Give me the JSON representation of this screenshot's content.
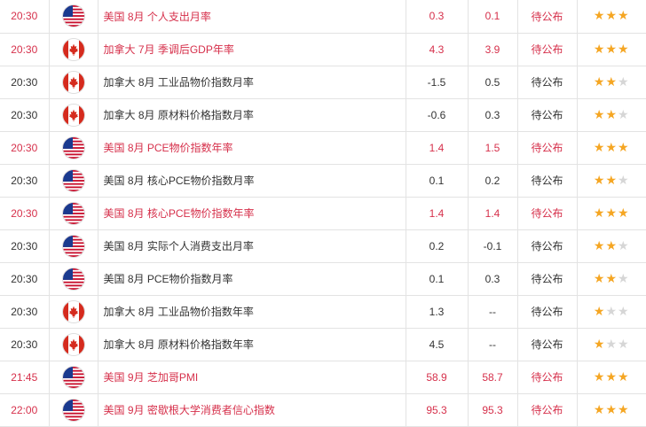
{
  "colors": {
    "highlight": "#d6304b",
    "star": "#f5a623",
    "star_empty": "#d6d6d6",
    "grid": "#e3e3e3"
  },
  "rows": [
    {
      "time": "20:30",
      "flag": "us-flag-icon",
      "event": "美国 8月 个人支出月率",
      "actual": "0.3",
      "forecast": "0.1",
      "status": "待公布",
      "importance": 3,
      "highlight": true
    },
    {
      "time": "20:30",
      "flag": "ca-flag-icon",
      "event": "加拿大 7月 季调后GDP年率",
      "actual": "4.3",
      "forecast": "3.9",
      "status": "待公布",
      "importance": 3,
      "highlight": true
    },
    {
      "time": "20:30",
      "flag": "ca-flag-icon",
      "event": "加拿大 8月 工业品物价指数月率",
      "actual": "-1.5",
      "forecast": "0.5",
      "status": "待公布",
      "importance": 2,
      "highlight": false
    },
    {
      "time": "20:30",
      "flag": "ca-flag-icon",
      "event": "加拿大 8月 原材料价格指数月率",
      "actual": "-0.6",
      "forecast": "0.3",
      "status": "待公布",
      "importance": 2,
      "highlight": false
    },
    {
      "time": "20:30",
      "flag": "us-flag-icon",
      "event": "美国 8月 PCE物价指数年率",
      "actual": "1.4",
      "forecast": "1.5",
      "status": "待公布",
      "importance": 3,
      "highlight": true
    },
    {
      "time": "20:30",
      "flag": "us-flag-icon",
      "event": "美国 8月 核心PCE物价指数月率",
      "actual": "0.1",
      "forecast": "0.2",
      "status": "待公布",
      "importance": 2,
      "highlight": false
    },
    {
      "time": "20:30",
      "flag": "us-flag-icon",
      "event": "美国 8月 核心PCE物价指数年率",
      "actual": "1.4",
      "forecast": "1.4",
      "status": "待公布",
      "importance": 3,
      "highlight": true
    },
    {
      "time": "20:30",
      "flag": "us-flag-icon",
      "event": "美国 8月 实际个人消费支出月率",
      "actual": "0.2",
      "forecast": "-0.1",
      "status": "待公布",
      "importance": 2,
      "highlight": false
    },
    {
      "time": "20:30",
      "flag": "us-flag-icon",
      "event": "美国 8月 PCE物价指数月率",
      "actual": "0.1",
      "forecast": "0.3",
      "status": "待公布",
      "importance": 2,
      "highlight": false
    },
    {
      "time": "20:30",
      "flag": "ca-flag-icon",
      "event": "加拿大 8月 工业品物价指数年率",
      "actual": "1.3",
      "forecast": "--",
      "status": "待公布",
      "importance": 1,
      "highlight": false
    },
    {
      "time": "20:30",
      "flag": "ca-flag-icon",
      "event": "加拿大 8月 原材料价格指数年率",
      "actual": "4.5",
      "forecast": "--",
      "status": "待公布",
      "importance": 1,
      "highlight": false
    },
    {
      "time": "21:45",
      "flag": "us-flag-icon",
      "event": "美国 9月 芝加哥PMI",
      "actual": "58.9",
      "forecast": "58.7",
      "status": "待公布",
      "importance": 3,
      "highlight": true
    },
    {
      "time": "22:00",
      "flag": "us-flag-icon",
      "event": "美国 9月 密歇根大学消费者信心指数",
      "actual": "95.3",
      "forecast": "95.3",
      "status": "待公布",
      "importance": 3,
      "highlight": true
    }
  ]
}
